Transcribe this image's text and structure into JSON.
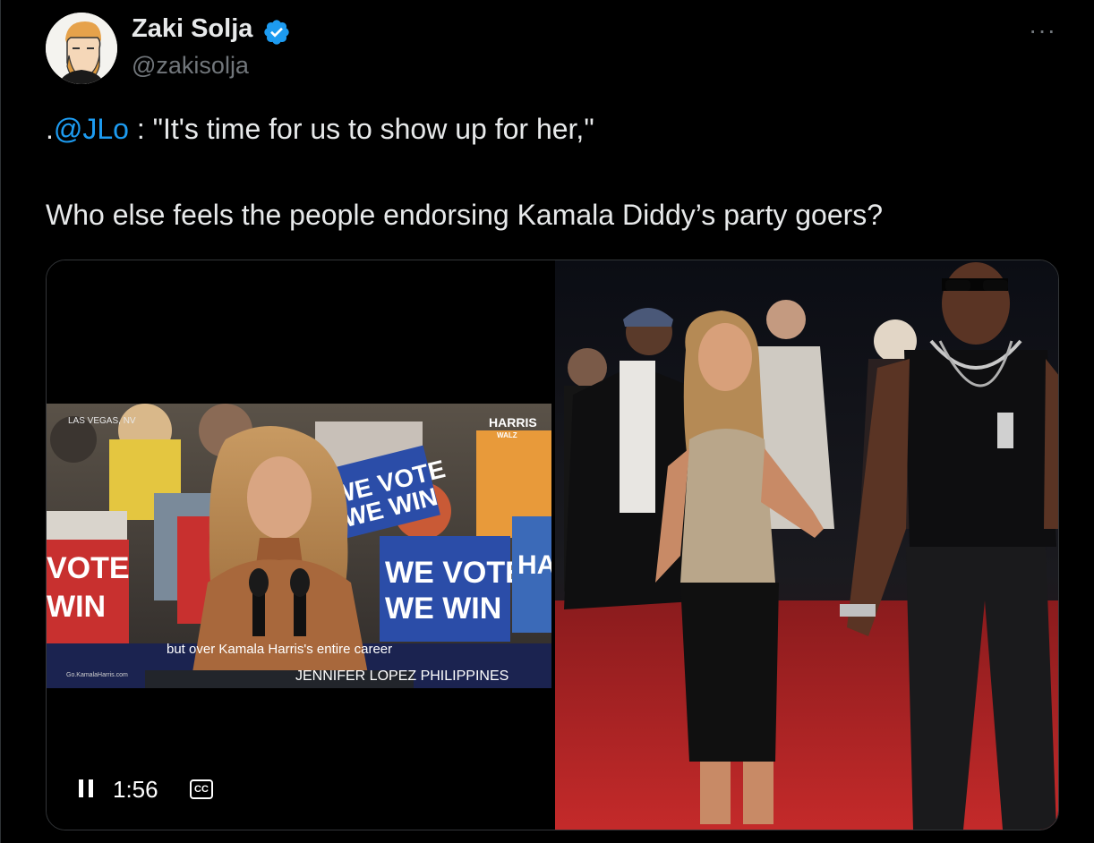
{
  "user": {
    "name": "Zaki Solja",
    "handle": "@zakisolja",
    "more_label": "···"
  },
  "tweet": {
    "line1_prefix": ".",
    "mention": "@JLo",
    "line1_rest": " : \"It's time for us to show up for her,\"",
    "line2": "Who else feels the people endorsing Kamala Diddy’s party goers?"
  },
  "video": {
    "location": "LAS VEGAS, NV",
    "logo_top": "HARRIS",
    "logo_bottom": "WALZ",
    "caption": "but over Kamala Harris's entire career",
    "site": "Go.KamalaHarris.com",
    "watermark": "JENNIFER LOPEZ PHILIPPINES",
    "sign1_line1": "WE VOTE",
    "sign1_line2": "WE WIN",
    "sign2_line1": "VOTE",
    "sign2_line2": "WIN",
    "sign3_line1": "WE VOTE",
    "sign3_line2": "WE WIN",
    "sign_partial": "HA",
    "time": "1:56",
    "cc_label": "CC"
  },
  "colors": {
    "background": "#000000",
    "text": "#e7e9ea",
    "secondary": "#71767b",
    "link": "#1d9bf0",
    "verified": "#1d9bf0"
  }
}
